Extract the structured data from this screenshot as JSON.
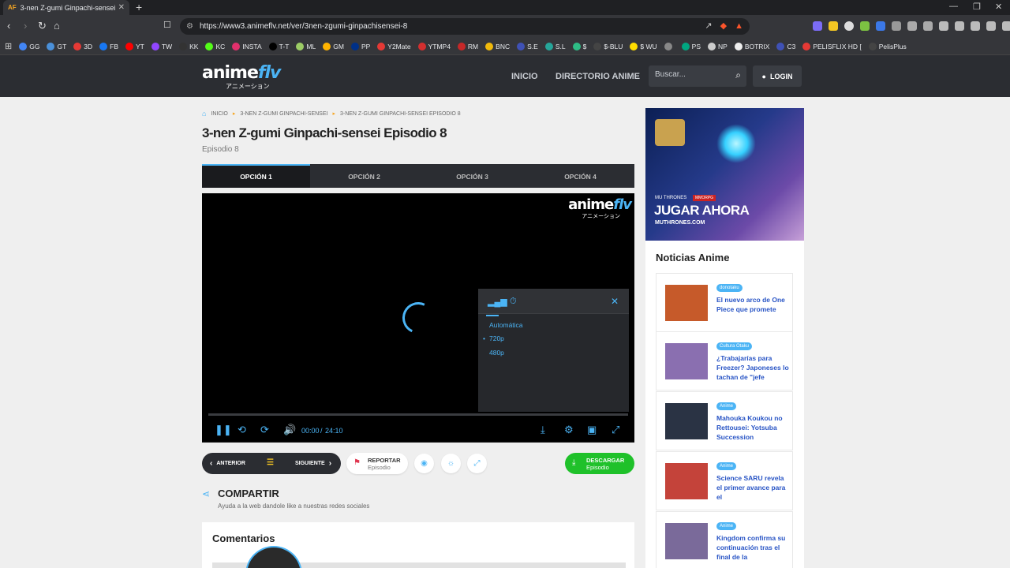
{
  "browser": {
    "tab_favicon": "AF",
    "tab_title": "3-nen Z-gumi Ginpachi-sensei E",
    "url": "https://www3.animeflv.net/ver/3nen-zgumi-ginpachisensei-8",
    "bookmarks": [
      {
        "label": "GG",
        "color": "#4285f4"
      },
      {
        "label": "GT",
        "color": "#4a90d9"
      },
      {
        "label": "3D",
        "color": "#e53935"
      },
      {
        "label": "FB",
        "color": "#1877f2"
      },
      {
        "label": "YT",
        "color": "#ff0000"
      },
      {
        "label": "TW",
        "color": "#9146ff"
      },
      {
        "label": "KK",
        "color": "#333333"
      },
      {
        "label": "KC",
        "color": "#53fc18"
      },
      {
        "label": "INSTA",
        "color": "#e1306c"
      },
      {
        "label": "T-T",
        "color": "#000000"
      },
      {
        "label": "ML",
        "color": "#9ccc65"
      },
      {
        "label": "GM",
        "color": "#ffb300"
      },
      {
        "label": "PP",
        "color": "#003087"
      },
      {
        "label": "Y2Mate",
        "color": "#e53935"
      },
      {
        "label": "YTMP4",
        "color": "#d32f2f"
      },
      {
        "label": "RM",
        "color": "#c62828"
      },
      {
        "label": "BNC",
        "color": "#f0b90b"
      },
      {
        "label": "S.E",
        "color": "#3f51b5"
      },
      {
        "label": "S.L",
        "color": "#26a69a"
      },
      {
        "label": "$",
        "color": "#2ebd85"
      },
      {
        "label": "$-BLU",
        "color": "#444444"
      },
      {
        "label": "$ WU",
        "color": "#ffdd00"
      },
      {
        "label": "",
        "color": "#888888"
      },
      {
        "label": "PS",
        "color": "#00a680"
      },
      {
        "label": "NP",
        "color": "#cccccc"
      },
      {
        "label": "BOTRIX",
        "color": "#eeeeee"
      },
      {
        "label": "C3",
        "color": "#3f51b5"
      },
      {
        "label": "PELISFLIX HD [",
        "color": "#e53935"
      },
      {
        "label": "PelisPlus",
        "color": "#444444"
      }
    ]
  },
  "site": {
    "logo_main": "anime",
    "logo_accent": "flv",
    "logo_sub": "アニメーション",
    "nav": {
      "home": "INICIO",
      "directory": "DIRECTORIO ANIME"
    },
    "search_placeholder": "Buscar...",
    "login": "LOGIN"
  },
  "breadcrumb": [
    "INICIO",
    "3-NEN Z-GUMI GINPACHI-SENSEI",
    "3-NEN Z-GUMI GINPACHI-SENSEI EPISODIO 8"
  ],
  "episode": {
    "title": "3-nen Z-gumi Ginpachi-sensei Episodio 8",
    "subtitle": "Episodio 8"
  },
  "options": [
    "OPCIÓN 1",
    "OPCIÓN 2",
    "OPCIÓN 3",
    "OPCIÓN 4"
  ],
  "player": {
    "quality_options": [
      "Automática",
      "720p",
      "480p"
    ],
    "selected_quality": "720p",
    "current_time": "00:00",
    "time_separator": "/",
    "duration": "24:10",
    "progress_fraction": 0
  },
  "actions": {
    "prev": "ANTERIOR",
    "next": "SIGUIENTE",
    "report_title": "REPORTAR",
    "report_sub": "Episodio",
    "download_title": "DESCARGAR",
    "download_sub": "Episodio"
  },
  "share": {
    "title": "COMPARTIR",
    "subtitle": "Ayuda a la web dandole like a nuestras redes sociales"
  },
  "comments": {
    "title": "Comentarios"
  },
  "ad": {
    "brand": "MU THRONES",
    "badge": "MMORPG",
    "cta": "JUGAR AHORA",
    "url": "MUTHRONES.COM"
  },
  "news": {
    "title": "Noticias Anime",
    "items": [
      {
        "tag": "donotaku",
        "text": "El nuevo arco de One Piece que promete",
        "thumb": "#c65a2a"
      },
      {
        "tag": "Cultura Otaku",
        "text": "¿Trabajarías para Freezer? Japoneses lo tachan de \"jefe",
        "thumb": "#8a6fb0"
      },
      {
        "tag": "Anime",
        "text": "Mahouka Koukou no Rettousei: Yotsuba Succession",
        "thumb": "#2a3344"
      },
      {
        "tag": "Anime",
        "text": "Science SARU revela el primer avance para el",
        "thumb": "#c4433a"
      },
      {
        "tag": "Anime",
        "text": "Kingdom confirma su continuación tras el final de la",
        "thumb": "#7a6a9a"
      }
    ]
  },
  "colors": {
    "accent": "#4bb4f5",
    "download": "#1fc12a",
    "header": "#2b2d32"
  }
}
